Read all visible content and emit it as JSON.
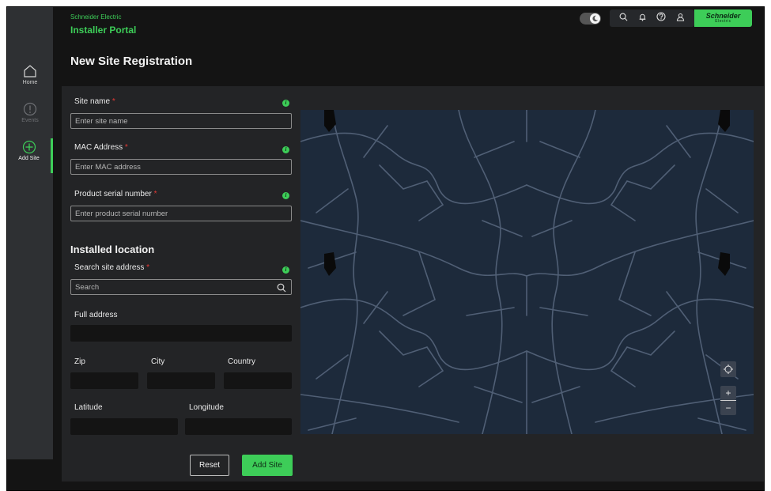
{
  "header": {
    "company": "Schneider Electric",
    "portal": "Installer Portal",
    "logo_line1": "Schneider",
    "logo_line2": "Electric"
  },
  "sidebar": {
    "items": [
      {
        "label": "Home",
        "icon": "home-icon",
        "state": "default"
      },
      {
        "label": "Events",
        "icon": "alert-icon",
        "state": "disabled"
      },
      {
        "label": "Add Site",
        "icon": "add-circle-icon",
        "state": "active"
      }
    ]
  },
  "toolbar": {
    "icons": [
      "search-icon",
      "bell-icon",
      "help-icon",
      "user-icon"
    ]
  },
  "page": {
    "title": "New Site Registration"
  },
  "form": {
    "site_name": {
      "label": "Site name",
      "placeholder": "Enter site name"
    },
    "mac": {
      "label": "MAC Address",
      "placeholder": "Enter MAC address"
    },
    "serial": {
      "label": "Product serial number",
      "placeholder": "Enter product serial number"
    },
    "location_heading": "Installed location",
    "search": {
      "label": "Search site address",
      "placeholder": "Search"
    },
    "full_address": {
      "label": "Full address"
    },
    "zip": {
      "label": "Zip"
    },
    "city": {
      "label": "City"
    },
    "country": {
      "label": "Country"
    },
    "latitude": {
      "label": "Latitude"
    },
    "longitude": {
      "label": "Longitude"
    },
    "required_mark": "*",
    "info_glyph": "i",
    "reset_label": "Reset",
    "add_label": "Add Site"
  },
  "map": {
    "zoom_in": "+",
    "zoom_out": "−"
  },
  "colors": {
    "accent": "#3dcd58",
    "background": "#141414",
    "panel": "#232426",
    "sidebar": "#2e3033",
    "map": "#1d2a3b",
    "required": "#e53935"
  }
}
